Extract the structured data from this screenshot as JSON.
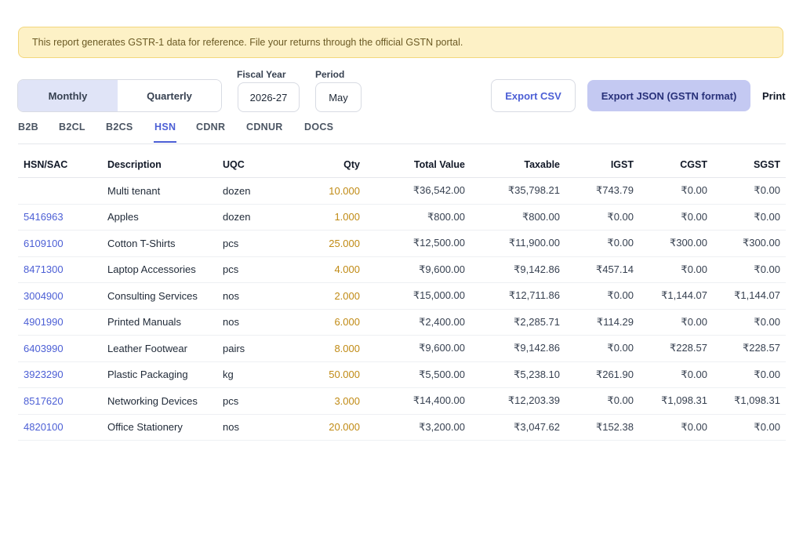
{
  "notice": "This report generates GSTR-1 data for reference. File your returns through the official GSTN portal.",
  "period_toggle": {
    "monthly": "Monthly",
    "quarterly": "Quarterly",
    "selected": "Monthly"
  },
  "fiscal_year": {
    "label": "Fiscal Year",
    "value": "2026-27"
  },
  "period": {
    "label": "Period",
    "value": "May"
  },
  "actions": {
    "export_csv": "Export CSV",
    "export_json": "Export JSON (GSTN format)",
    "print": "Print"
  },
  "tabs": [
    "B2B",
    "B2CL",
    "B2CS",
    "HSN",
    "CDNR",
    "CDNUR",
    "DOCS"
  ],
  "active_tab": "HSN",
  "colors": {
    "accent": "#4c5fd5",
    "qty": "#c08a14",
    "notice_bg": "#fdf1c6"
  },
  "table": {
    "headers": [
      "HSN/SAC",
      "Description",
      "UQC",
      "Qty",
      "Total Value",
      "Taxable",
      "IGST",
      "CGST",
      "SGST"
    ],
    "rows": [
      [
        "",
        "Multi tenant",
        "dozen",
        "10.000",
        "₹36,542.00",
        "₹35,798.21",
        "₹743.79",
        "₹0.00",
        "₹0.00"
      ],
      [
        "5416963",
        "Apples",
        "dozen",
        "1.000",
        "₹800.00",
        "₹800.00",
        "₹0.00",
        "₹0.00",
        "₹0.00"
      ],
      [
        "6109100",
        "Cotton T-Shirts",
        "pcs",
        "25.000",
        "₹12,500.00",
        "₹11,900.00",
        "₹0.00",
        "₹300.00",
        "₹300.00"
      ],
      [
        "8471300",
        "Laptop Accessories",
        "pcs",
        "4.000",
        "₹9,600.00",
        "₹9,142.86",
        "₹457.14",
        "₹0.00",
        "₹0.00"
      ],
      [
        "3004900",
        "Consulting Services",
        "nos",
        "2.000",
        "₹15,000.00",
        "₹12,711.86",
        "₹0.00",
        "₹1,144.07",
        "₹1,144.07"
      ],
      [
        "4901990",
        "Printed Manuals",
        "nos",
        "6.000",
        "₹2,400.00",
        "₹2,285.71",
        "₹114.29",
        "₹0.00",
        "₹0.00"
      ],
      [
        "6403990",
        "Leather Footwear",
        "pairs",
        "8.000",
        "₹9,600.00",
        "₹9,142.86",
        "₹0.00",
        "₹228.57",
        "₹228.57"
      ],
      [
        "3923290",
        "Plastic Packaging",
        "kg",
        "50.000",
        "₹5,500.00",
        "₹5,238.10",
        "₹261.90",
        "₹0.00",
        "₹0.00"
      ],
      [
        "8517620",
        "Networking Devices",
        "pcs",
        "3.000",
        "₹14,400.00",
        "₹12,203.39",
        "₹0.00",
        "₹1,098.31",
        "₹1,098.31"
      ],
      [
        "4820100",
        "Office Stationery",
        "nos",
        "20.000",
        "₹3,200.00",
        "₹3,047.62",
        "₹152.38",
        "₹0.00",
        "₹0.00"
      ]
    ]
  }
}
